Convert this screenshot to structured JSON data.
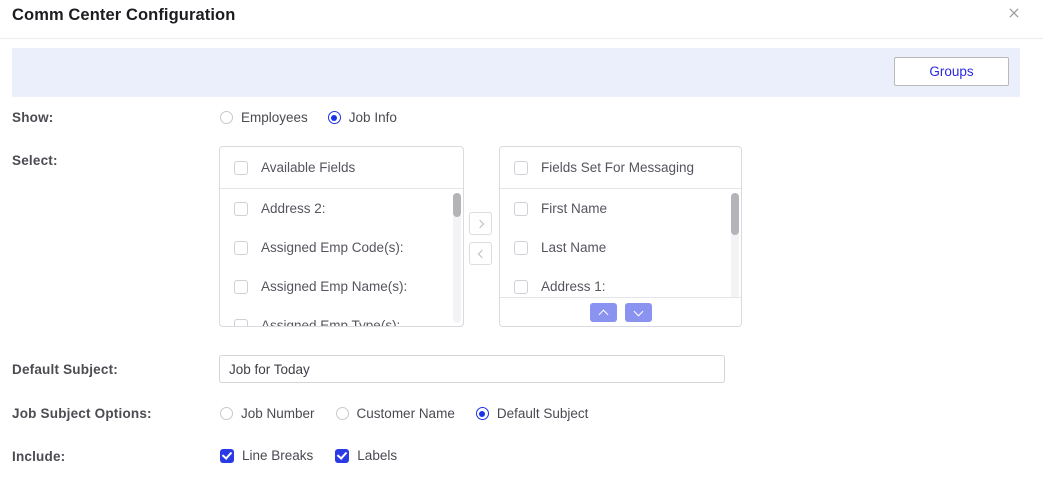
{
  "dialog": {
    "title": "Comm Center Configuration",
    "close_icon": "close-icon"
  },
  "toolbar": {
    "groups_label": "Groups"
  },
  "rows": {
    "show_label": "Show:",
    "select_label": "Select:",
    "default_subject_label": "Default Subject:",
    "job_subject_options_label": "Job Subject Options:",
    "include_label": "Include:"
  },
  "show_options": [
    {
      "label": "Employees",
      "selected": false
    },
    {
      "label": "Job Info",
      "selected": true
    }
  ],
  "available_fields": {
    "header": "Available Fields",
    "items": [
      "Address 2:",
      "Assigned Emp Code(s):",
      "Assigned Emp Name(s):",
      "Assigned Emp Type(s):"
    ]
  },
  "selected_fields": {
    "header": "Fields Set For Messaging",
    "items": [
      "First Name",
      "Last Name",
      "Address 1:"
    ],
    "move_up_icon": "chevron-up-icon",
    "move_down_icon": "chevron-down-icon"
  },
  "transfer": {
    "add_icon": "chevron-right-icon",
    "remove_icon": "chevron-left-icon"
  },
  "default_subject": {
    "value": "Job for Today",
    "placeholder": ""
  },
  "job_subject_options": [
    {
      "label": "Job Number",
      "selected": false
    },
    {
      "label": "Customer Name",
      "selected": false
    },
    {
      "label": "Default Subject",
      "selected": true
    }
  ],
  "include_options": [
    {
      "label": "Line Breaks",
      "checked": true
    },
    {
      "label": "Labels",
      "checked": true
    }
  ],
  "colors": {
    "accent_blue": "#2a3ae4",
    "link_blue": "#2a2ae0",
    "toolbar_band": "#ebeefb",
    "move_button": "#8a93ef"
  }
}
